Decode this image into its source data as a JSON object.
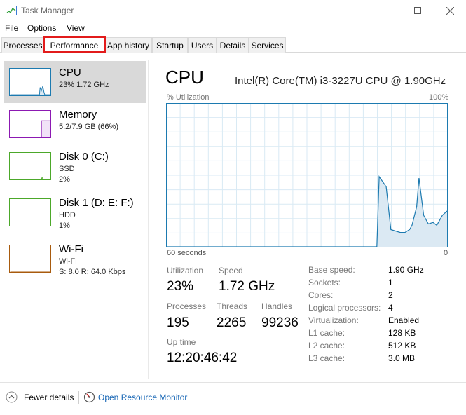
{
  "window": {
    "title": "Task Manager",
    "icon": "task-manager-icon",
    "controls": {
      "minimize": "—",
      "maximize": "□",
      "close": "✕"
    }
  },
  "menu": [
    "File",
    "Options",
    "View"
  ],
  "tabs": [
    "Processes",
    "Performance",
    "App history",
    "Startup",
    "Users",
    "Details",
    "Services"
  ],
  "active_tab": "Performance",
  "accent": {
    "cpu": "#1c7ab0",
    "memory": "#8c19b2",
    "disk": "#4ca82a",
    "wifi": "#a85b0e",
    "highlight": "#e21b1b",
    "link": "#1464b4"
  },
  "sidebar": [
    {
      "name": "CPU",
      "lines": [
        "23%  1.72 GHz"
      ]
    },
    {
      "name": "Memory",
      "lines": [
        "5.2/7.9 GB (66%)"
      ]
    },
    {
      "name": "Disk 0 (C:)",
      "lines": [
        "SSD",
        "2%"
      ]
    },
    {
      "name": "Disk 1 (D: E: F:)",
      "lines": [
        "HDD",
        "1%"
      ]
    },
    {
      "name": "Wi-Fi",
      "lines": [
        "Wi-Fi",
        "S: 8.0  R: 64.0 Kbps"
      ]
    }
  ],
  "main": {
    "title": "CPU",
    "model": "Intel(R) Core(TM) i3-3227U CPU @ 1.90GHz",
    "util_label": "% Utilization",
    "max_label": "100%",
    "time_label": "60 seconds",
    "zero_label": "0",
    "stats": {
      "utilization": {
        "label": "Utilization",
        "value": "23%"
      },
      "speed": {
        "label": "Speed",
        "value": "1.72 GHz"
      },
      "processes": {
        "label": "Processes",
        "value": "195"
      },
      "threads": {
        "label": "Threads",
        "value": "2265"
      },
      "handles": {
        "label": "Handles",
        "value": "99236"
      },
      "uptime": {
        "label": "Up time",
        "value": "12:20:46:42"
      }
    },
    "info": [
      {
        "key": "Base speed:",
        "value": "1.90 GHz"
      },
      {
        "key": "Sockets:",
        "value": "1"
      },
      {
        "key": "Cores:",
        "value": "2"
      },
      {
        "key": "Logical processors:",
        "value": "4"
      },
      {
        "key": "Virtualization:",
        "value": "Enabled"
      },
      {
        "key": "L1 cache:",
        "value": "128 KB"
      },
      {
        "key": "L2 cache:",
        "value": "512 KB"
      },
      {
        "key": "L3 cache:",
        "value": "3.0 MB"
      }
    ]
  },
  "chart_data": {
    "type": "area",
    "x_range": [
      60,
      0
    ],
    "ylim": [
      0,
      100
    ],
    "grid": true,
    "x": [
      60,
      15,
      14.5,
      13,
      12,
      10,
      9,
      8,
      7.5,
      6.5,
      6,
      5,
      4,
      3,
      2.2,
      1,
      0
    ],
    "values": [
      0,
      0,
      49,
      42,
      12,
      10,
      10,
      12,
      15,
      28,
      48,
      22,
      16,
      17,
      15,
      22,
      25
    ]
  },
  "footer": {
    "fewer": "Fewer details",
    "monitor": "Open Resource Monitor"
  }
}
